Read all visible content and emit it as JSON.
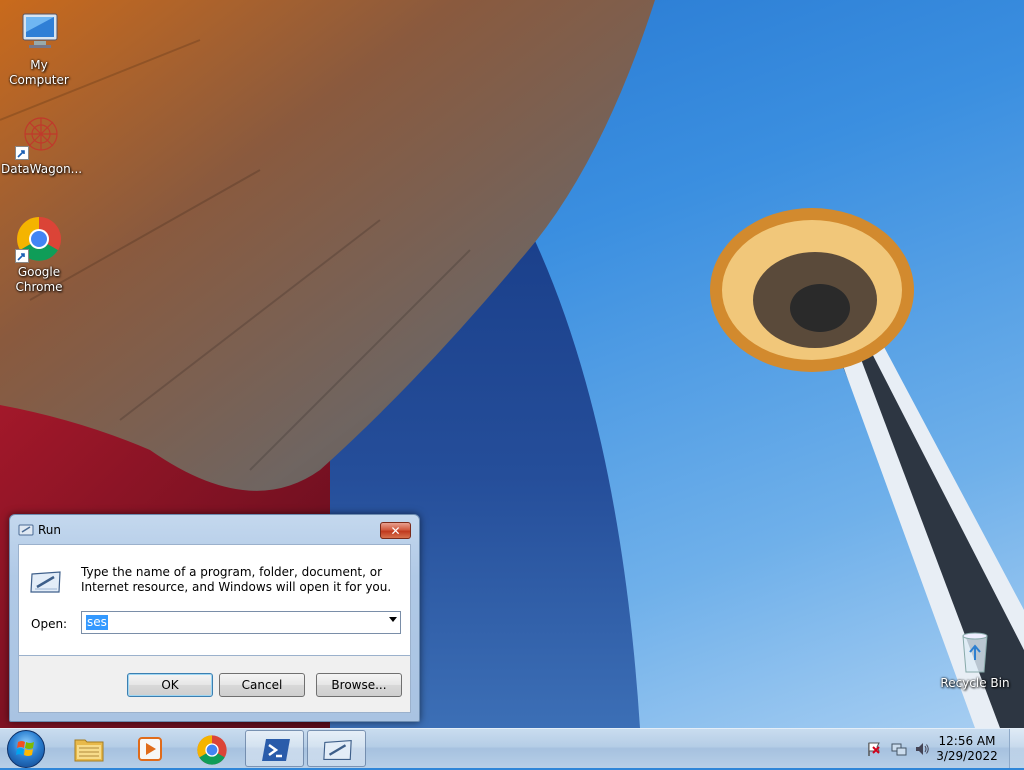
{
  "desktop": {
    "icons": [
      {
        "label": "My Computer",
        "icon": "computer-icon"
      },
      {
        "label": "DataWagon...",
        "icon": "datawagon-icon"
      },
      {
        "label": "Google Chrome",
        "icon": "chrome-icon"
      },
      {
        "label": "Recycle Bin",
        "icon": "recycle-bin-icon"
      }
    ]
  },
  "run_dialog": {
    "title": "Run",
    "close_label": "✕",
    "description": "Type the name of a program, folder, document, or Internet resource, and Windows will open it for you.",
    "open_label": "Open:",
    "open_value": "ses",
    "buttons": {
      "ok": "OK",
      "cancel": "Cancel",
      "browse": "Browse..."
    }
  },
  "taskbar": {
    "start_icon": "windows-logo-icon",
    "pinned": [
      {
        "name": "file-explorer",
        "icon": "folder-icon"
      },
      {
        "name": "media-player",
        "icon": "media-player-icon"
      },
      {
        "name": "chrome",
        "icon": "chrome-icon"
      },
      {
        "name": "powershell",
        "icon": "powershell-icon"
      },
      {
        "name": "run",
        "icon": "run-icon",
        "active": true
      }
    ],
    "tray": {
      "icons": [
        "action-center-flag-icon",
        "network-icon",
        "volume-icon"
      ],
      "time": "12:56 AM",
      "date": "3/29/2022"
    }
  },
  "colors": {
    "sky": "#3b8fe0",
    "taskbar": "#b5cde6",
    "selection": "#3399ff",
    "close_button": "#c0391e"
  }
}
